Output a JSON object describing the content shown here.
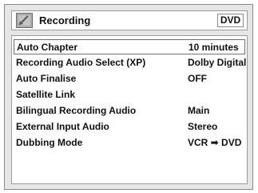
{
  "header": {
    "icon": "recording-folder-icon",
    "title": "Recording",
    "badge": "DVD"
  },
  "settings": [
    {
      "label": "Auto Chapter",
      "value": "10 minutes",
      "selected": true
    },
    {
      "label": "Recording Audio Select (XP)",
      "value": "Dolby Digital"
    },
    {
      "label": "Auto Finalise",
      "value": "OFF"
    },
    {
      "label": "Satellite Link",
      "value": ""
    },
    {
      "label": "Bilingual Recording Audio",
      "value": "Main"
    },
    {
      "label": "External Input Audio",
      "value": "Stereo"
    },
    {
      "label": "Dubbing Mode",
      "value": "VCR ➡ DVD"
    }
  ],
  "colors": {
    "background": "#e6e6e6",
    "panel": "#ffffff",
    "border": "#9a9a9a",
    "text": "#111111"
  }
}
